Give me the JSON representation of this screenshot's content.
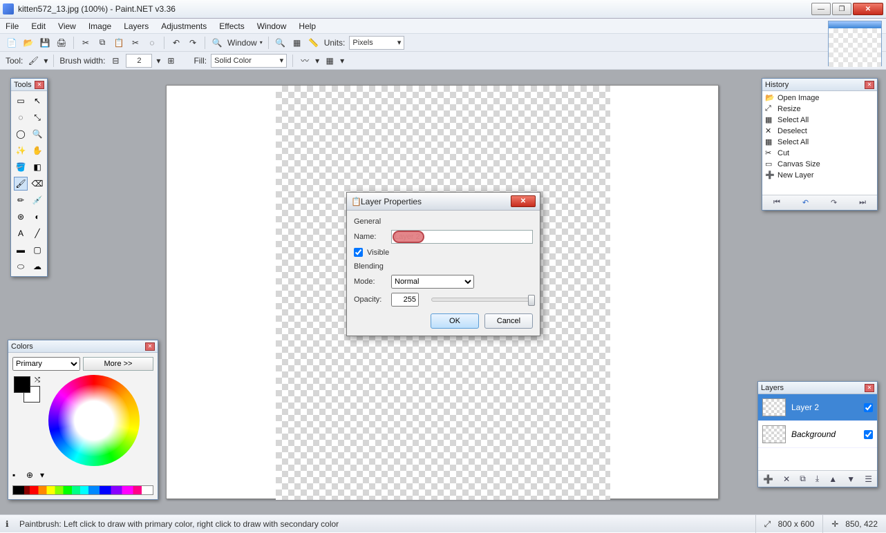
{
  "window": {
    "title": "kitten572_13.jpg (100%) - Paint.NET v3.36"
  },
  "menus": [
    "File",
    "Edit",
    "View",
    "Image",
    "Layers",
    "Adjustments",
    "Effects",
    "Window",
    "Help"
  ],
  "toolbar1": {
    "window_menu": "Window",
    "units_label": "Units:",
    "units_value": "Pixels"
  },
  "toolbar2": {
    "tool_label": "Tool:",
    "brush_label": "Brush width:",
    "brush_value": "2",
    "fill_label": "Fill:",
    "fill_value": "Solid Color"
  },
  "panels": {
    "tools_title": "Tools",
    "colors_title": "Colors",
    "history_title": "History",
    "layers_title": "Layers"
  },
  "colors": {
    "target": "Primary",
    "more": "More >>"
  },
  "history_items": [
    {
      "icon": "open",
      "label": "Open Image"
    },
    {
      "icon": "resize",
      "label": "Resize"
    },
    {
      "icon": "selall",
      "label": "Select All"
    },
    {
      "icon": "deselect",
      "label": "Deselect"
    },
    {
      "icon": "selall",
      "label": "Select All"
    },
    {
      "icon": "cut",
      "label": "Cut"
    },
    {
      "icon": "canvas",
      "label": "Canvas Size"
    },
    {
      "icon": "newlayer",
      "label": "New Layer"
    }
  ],
  "layers": {
    "items": [
      {
        "name": "Layer 2",
        "visible": true,
        "selected": true,
        "italic": false
      },
      {
        "name": "Background",
        "visible": true,
        "selected": false,
        "italic": true
      }
    ]
  },
  "dialog": {
    "title": "Layer Properties",
    "section_general": "General",
    "name_label": "Name:",
    "name_value": "Layer 2",
    "visible_label": "Visible",
    "visible_checked": true,
    "section_blending": "Blending",
    "mode_label": "Mode:",
    "mode_value": "Normal",
    "opacity_label": "Opacity:",
    "opacity_value": "255",
    "ok": "OK",
    "cancel": "Cancel"
  },
  "status": {
    "hint": "Paintbrush: Left click to draw with primary color, right click to draw with secondary color",
    "size": "800 x 600",
    "pos": "850, 422"
  }
}
